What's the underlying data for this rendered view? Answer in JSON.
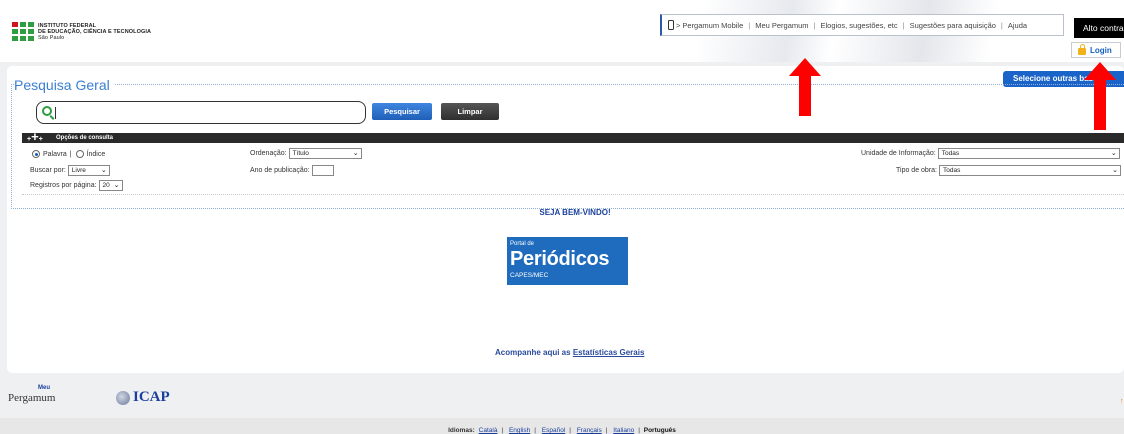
{
  "header": {
    "logo": {
      "line1": "INSTITUTO FEDERAL",
      "line2": "DE EDUCAÇÃO, CIÊNCIA E TECNOLOGIA",
      "line3": "São Paulo"
    },
    "links": [
      "Pergamum Mobile",
      "Meu Pergamum",
      "Elogios, sugestões, etc",
      "Sugestões para aquisição",
      "Ajuda"
    ],
    "contrast_label": "Alto contraste",
    "login_label": "Login"
  },
  "search": {
    "title": "Pesquisa Geral",
    "other_bases_label": "Selecione outras bases",
    "input_value": "",
    "search_button": "Pesquisar",
    "clear_button": "Limpar",
    "options_label": "Opções de consulta",
    "radio_word": "Palavra",
    "radio_index": "Índice",
    "search_by_label": "Buscar por:",
    "search_by_value": "Livre",
    "per_page_label": "Registros por página:",
    "per_page_value": "20",
    "order_label": "Ordenação:",
    "order_value": "Título",
    "year_label": "Ano de publicação:",
    "unit_label": "Unidade de Informação:",
    "unit_value": "Todas",
    "work_type_label": "Tipo de obra:",
    "work_type_value": "Todas"
  },
  "welcome": "SEJA BEM-VINDO!",
  "periodicos": {
    "line1": "Portal de",
    "line2": "Periódicos",
    "line3": "CAPES/MEC"
  },
  "stats": {
    "prefix": "Acompanhe aqui as",
    "link": "Estatísticas Gerais"
  },
  "footer": {
    "pergamum_meu": "Meu",
    "pergamum_text": "Pergamum",
    "icap_text": "ICAP",
    "languages_label": "Idiomas:",
    "languages": [
      "Català",
      "English",
      "Español",
      "Français",
      "Italiano"
    ],
    "current_language": "Português"
  },
  "colors": {
    "accent_blue": "#1a63c9",
    "if_green": "#2f9e41",
    "if_red": "#cd191e",
    "annotation_red": "#ff0000"
  }
}
